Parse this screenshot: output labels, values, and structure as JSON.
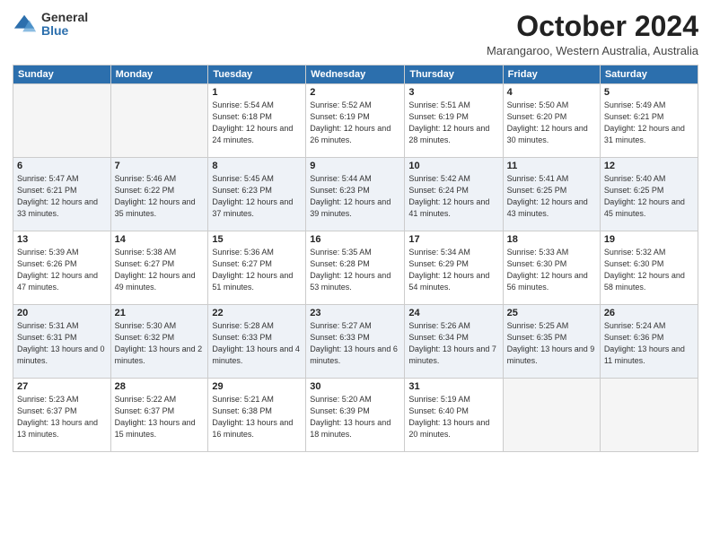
{
  "logo": {
    "general": "General",
    "blue": "Blue"
  },
  "title": "October 2024",
  "location": "Marangaroo, Western Australia, Australia",
  "days_of_week": [
    "Sunday",
    "Monday",
    "Tuesday",
    "Wednesday",
    "Thursday",
    "Friday",
    "Saturday"
  ],
  "weeks": [
    [
      {
        "day": "",
        "empty": true
      },
      {
        "day": "",
        "empty": true
      },
      {
        "day": "1",
        "sunrise": "Sunrise: 5:54 AM",
        "sunset": "Sunset: 6:18 PM",
        "daylight": "Daylight: 12 hours and 24 minutes."
      },
      {
        "day": "2",
        "sunrise": "Sunrise: 5:52 AM",
        "sunset": "Sunset: 6:19 PM",
        "daylight": "Daylight: 12 hours and 26 minutes."
      },
      {
        "day": "3",
        "sunrise": "Sunrise: 5:51 AM",
        "sunset": "Sunset: 6:19 PM",
        "daylight": "Daylight: 12 hours and 28 minutes."
      },
      {
        "day": "4",
        "sunrise": "Sunrise: 5:50 AM",
        "sunset": "Sunset: 6:20 PM",
        "daylight": "Daylight: 12 hours and 30 minutes."
      },
      {
        "day": "5",
        "sunrise": "Sunrise: 5:49 AM",
        "sunset": "Sunset: 6:21 PM",
        "daylight": "Daylight: 12 hours and 31 minutes."
      }
    ],
    [
      {
        "day": "6",
        "sunrise": "Sunrise: 5:47 AM",
        "sunset": "Sunset: 6:21 PM",
        "daylight": "Daylight: 12 hours and 33 minutes."
      },
      {
        "day": "7",
        "sunrise": "Sunrise: 5:46 AM",
        "sunset": "Sunset: 6:22 PM",
        "daylight": "Daylight: 12 hours and 35 minutes."
      },
      {
        "day": "8",
        "sunrise": "Sunrise: 5:45 AM",
        "sunset": "Sunset: 6:23 PM",
        "daylight": "Daylight: 12 hours and 37 minutes."
      },
      {
        "day": "9",
        "sunrise": "Sunrise: 5:44 AM",
        "sunset": "Sunset: 6:23 PM",
        "daylight": "Daylight: 12 hours and 39 minutes."
      },
      {
        "day": "10",
        "sunrise": "Sunrise: 5:42 AM",
        "sunset": "Sunset: 6:24 PM",
        "daylight": "Daylight: 12 hours and 41 minutes."
      },
      {
        "day": "11",
        "sunrise": "Sunrise: 5:41 AM",
        "sunset": "Sunset: 6:25 PM",
        "daylight": "Daylight: 12 hours and 43 minutes."
      },
      {
        "day": "12",
        "sunrise": "Sunrise: 5:40 AM",
        "sunset": "Sunset: 6:25 PM",
        "daylight": "Daylight: 12 hours and 45 minutes."
      }
    ],
    [
      {
        "day": "13",
        "sunrise": "Sunrise: 5:39 AM",
        "sunset": "Sunset: 6:26 PM",
        "daylight": "Daylight: 12 hours and 47 minutes."
      },
      {
        "day": "14",
        "sunrise": "Sunrise: 5:38 AM",
        "sunset": "Sunset: 6:27 PM",
        "daylight": "Daylight: 12 hours and 49 minutes."
      },
      {
        "day": "15",
        "sunrise": "Sunrise: 5:36 AM",
        "sunset": "Sunset: 6:27 PM",
        "daylight": "Daylight: 12 hours and 51 minutes."
      },
      {
        "day": "16",
        "sunrise": "Sunrise: 5:35 AM",
        "sunset": "Sunset: 6:28 PM",
        "daylight": "Daylight: 12 hours and 53 minutes."
      },
      {
        "day": "17",
        "sunrise": "Sunrise: 5:34 AM",
        "sunset": "Sunset: 6:29 PM",
        "daylight": "Daylight: 12 hours and 54 minutes."
      },
      {
        "day": "18",
        "sunrise": "Sunrise: 5:33 AM",
        "sunset": "Sunset: 6:30 PM",
        "daylight": "Daylight: 12 hours and 56 minutes."
      },
      {
        "day": "19",
        "sunrise": "Sunrise: 5:32 AM",
        "sunset": "Sunset: 6:30 PM",
        "daylight": "Daylight: 12 hours and 58 minutes."
      }
    ],
    [
      {
        "day": "20",
        "sunrise": "Sunrise: 5:31 AM",
        "sunset": "Sunset: 6:31 PM",
        "daylight": "Daylight: 13 hours and 0 minutes."
      },
      {
        "day": "21",
        "sunrise": "Sunrise: 5:30 AM",
        "sunset": "Sunset: 6:32 PM",
        "daylight": "Daylight: 13 hours and 2 minutes."
      },
      {
        "day": "22",
        "sunrise": "Sunrise: 5:28 AM",
        "sunset": "Sunset: 6:33 PM",
        "daylight": "Daylight: 13 hours and 4 minutes."
      },
      {
        "day": "23",
        "sunrise": "Sunrise: 5:27 AM",
        "sunset": "Sunset: 6:33 PM",
        "daylight": "Daylight: 13 hours and 6 minutes."
      },
      {
        "day": "24",
        "sunrise": "Sunrise: 5:26 AM",
        "sunset": "Sunset: 6:34 PM",
        "daylight": "Daylight: 13 hours and 7 minutes."
      },
      {
        "day": "25",
        "sunrise": "Sunrise: 5:25 AM",
        "sunset": "Sunset: 6:35 PM",
        "daylight": "Daylight: 13 hours and 9 minutes."
      },
      {
        "day": "26",
        "sunrise": "Sunrise: 5:24 AM",
        "sunset": "Sunset: 6:36 PM",
        "daylight": "Daylight: 13 hours and 11 minutes."
      }
    ],
    [
      {
        "day": "27",
        "sunrise": "Sunrise: 5:23 AM",
        "sunset": "Sunset: 6:37 PM",
        "daylight": "Daylight: 13 hours and 13 minutes."
      },
      {
        "day": "28",
        "sunrise": "Sunrise: 5:22 AM",
        "sunset": "Sunset: 6:37 PM",
        "daylight": "Daylight: 13 hours and 15 minutes."
      },
      {
        "day": "29",
        "sunrise": "Sunrise: 5:21 AM",
        "sunset": "Sunset: 6:38 PM",
        "daylight": "Daylight: 13 hours and 16 minutes."
      },
      {
        "day": "30",
        "sunrise": "Sunrise: 5:20 AM",
        "sunset": "Sunset: 6:39 PM",
        "daylight": "Daylight: 13 hours and 18 minutes."
      },
      {
        "day": "31",
        "sunrise": "Sunrise: 5:19 AM",
        "sunset": "Sunset: 6:40 PM",
        "daylight": "Daylight: 13 hours and 20 minutes."
      },
      {
        "day": "",
        "empty": true
      },
      {
        "day": "",
        "empty": true
      }
    ]
  ]
}
